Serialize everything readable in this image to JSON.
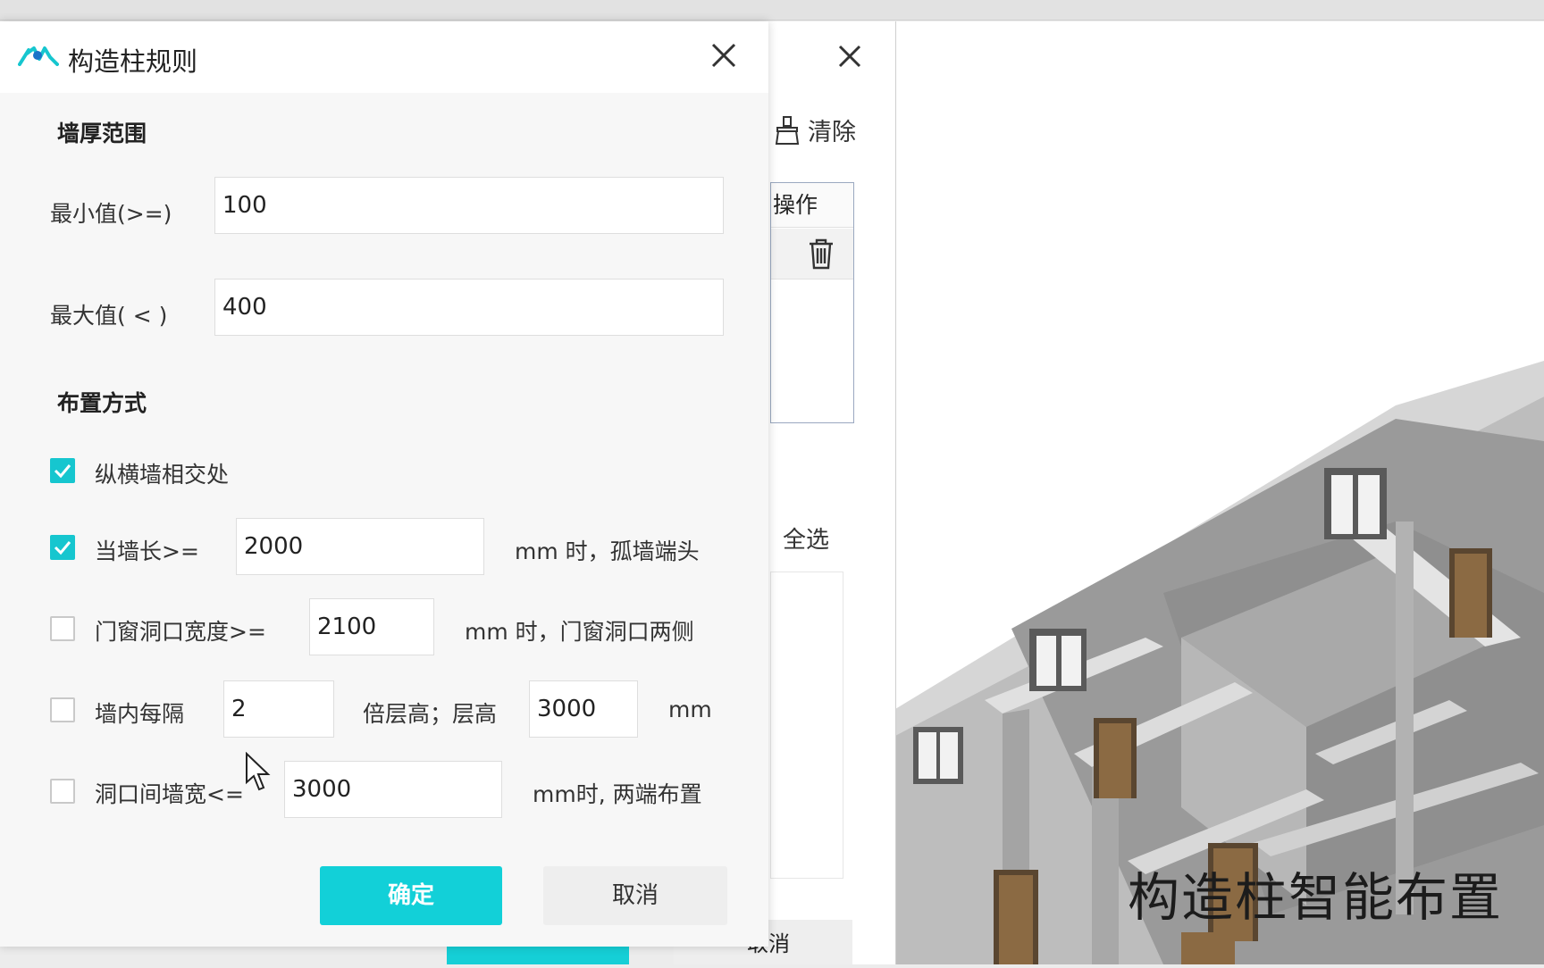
{
  "dialog": {
    "title": "构造柱规则",
    "section_wall_thickness": "墙厚范围",
    "min_label": "最小值(>=)",
    "min_value": "100",
    "max_label": "最大值( < )",
    "max_value": "400",
    "section_layout": "布置方式",
    "options": [
      {
        "checked": true,
        "label": "纵横墙相交处"
      },
      {
        "checked": true,
        "label": "当墙长>=",
        "value": "2000",
        "suffix": "mm 时，孤墙端头"
      },
      {
        "checked": false,
        "label": "门窗洞口宽度>=",
        "value": "2100",
        "suffix": "mm 时，门窗洞口两侧"
      },
      {
        "checked": false,
        "label": "墙内每隔",
        "value": "2",
        "middle": "倍层高；层高",
        "value2": "3000",
        "suffix": "mm"
      },
      {
        "checked": false,
        "label": "洞口间墙宽<=",
        "value": "3000",
        "suffix": "mm时, 两端布置"
      }
    ],
    "ok_label": "确定",
    "cancel_label": "取消"
  },
  "background_dialog": {
    "clear_label": "清除",
    "ops_header": "操作",
    "select_all": "全选",
    "cancel_partial": "取消"
  },
  "scene": {
    "caption": "构造柱智能布置"
  },
  "colors": {
    "accent": "#12d0d8"
  }
}
